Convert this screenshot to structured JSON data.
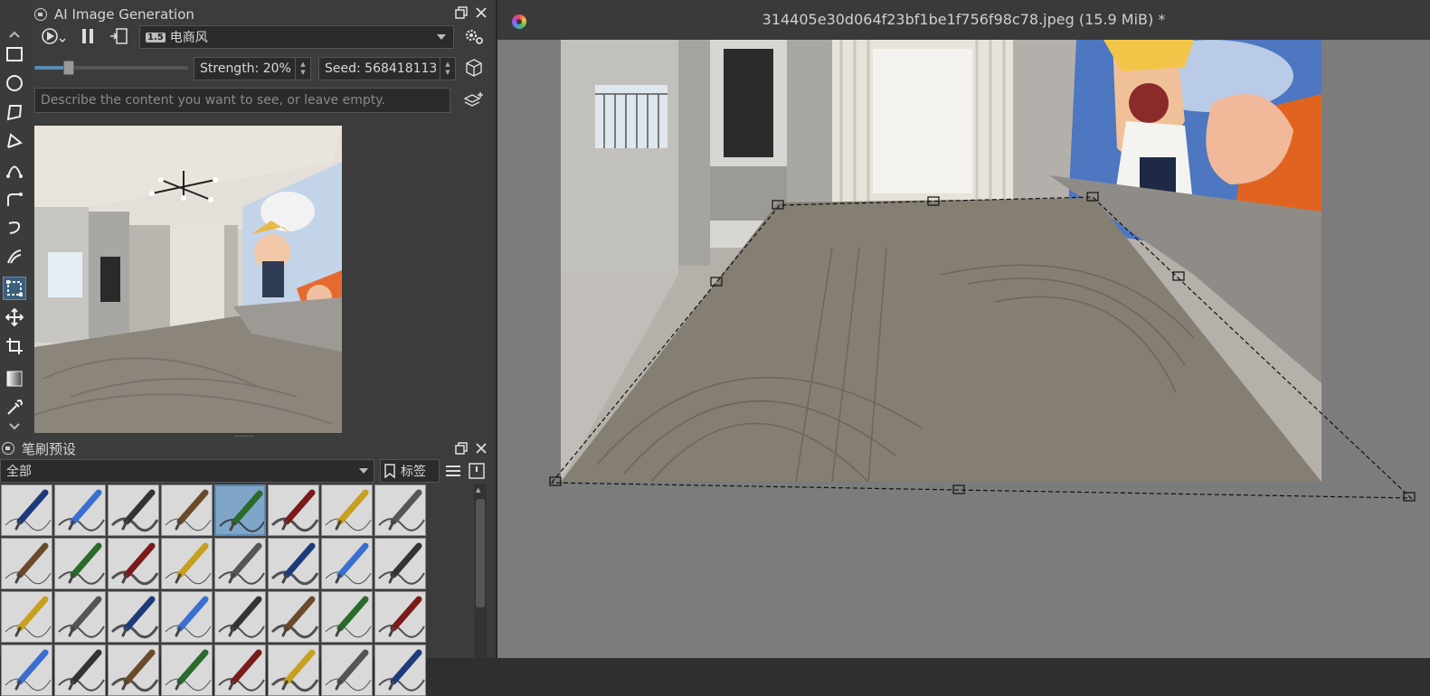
{
  "ai_panel": {
    "title": "AI Image Generation",
    "style_badge": "1.5",
    "style_name": "电商风",
    "strength_label": "Strength: 20%",
    "strength_value": 0.2,
    "seed_label": "Seed: 568418113",
    "prompt_placeholder": "Describe the content you want to see, or leave empty."
  },
  "brush_panel": {
    "title": "笔刷预设",
    "filter_value": "全部",
    "tag_label": "标签"
  },
  "document": {
    "title": "314405e30d064f23bf1be1f756f98c78.jpeg (15.9 MiB) *"
  },
  "colors": {
    "panel_bg": "#3c3c3c",
    "canvas_bg": "#7c7c7c",
    "selection_accent": "#5a8ab3"
  },
  "toolbox": {
    "tools": [
      "rectangle-tool-icon",
      "ellipse-tool-icon",
      "polygon-tool-icon",
      "polyline-tool-icon",
      "bezier-tool-icon",
      "freehand-path-icon",
      "dynamic-brush-icon",
      "multibrush-icon",
      "transform-tool-icon",
      "move-tool-icon",
      "crop-tool-icon",
      "gradient-tool-icon",
      "color-picker-icon"
    ],
    "active_tool": "transform-tool-icon"
  }
}
